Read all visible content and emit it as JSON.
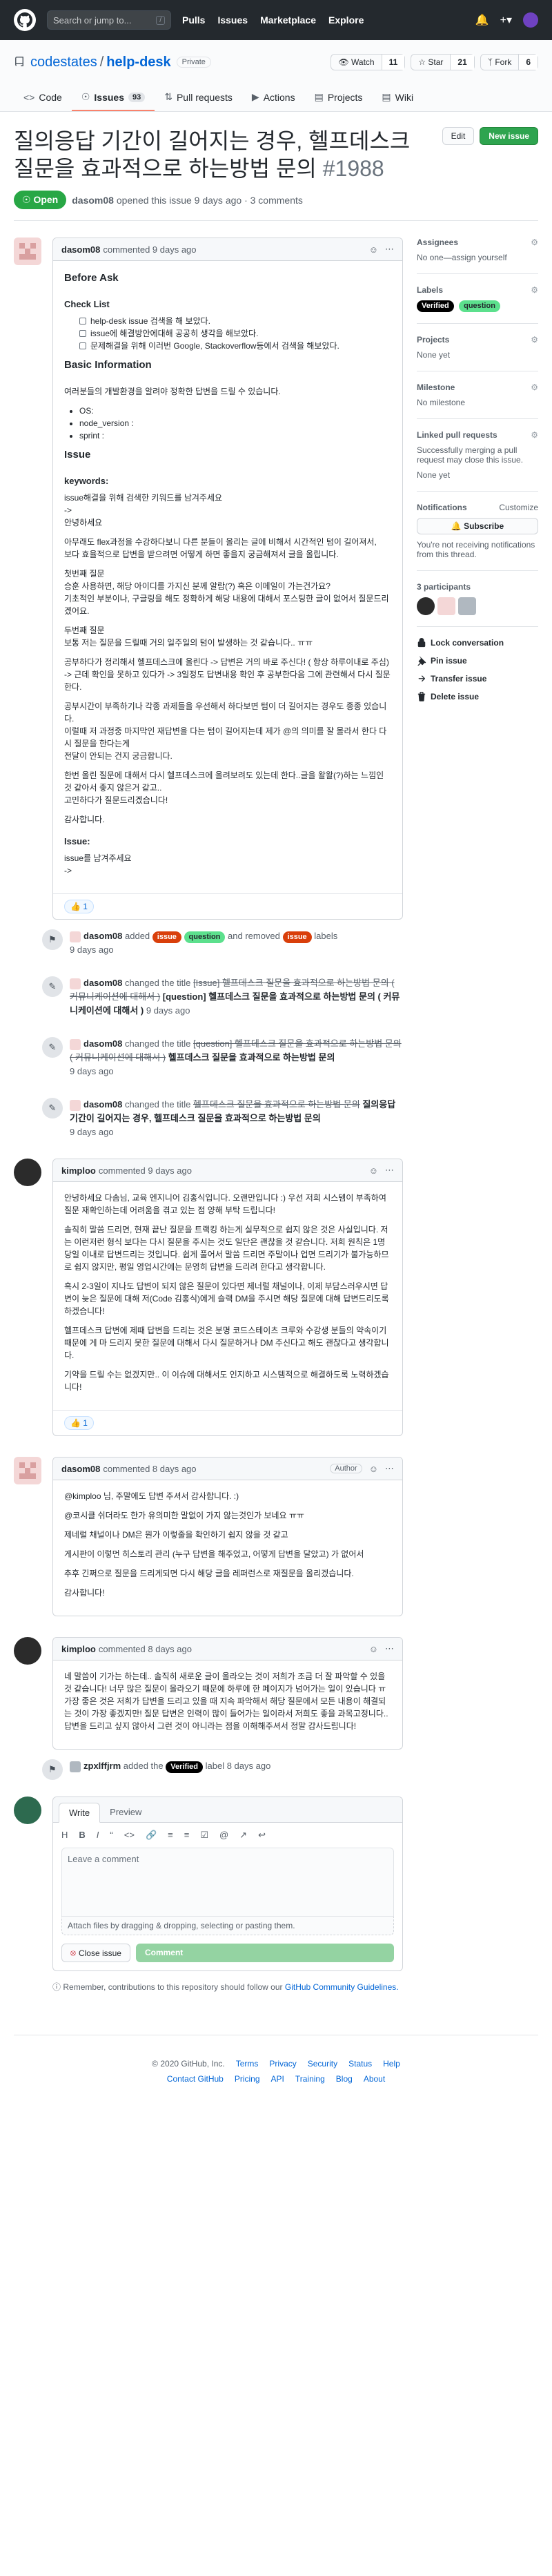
{
  "header": {
    "search_placeholder": "Search or jump to...",
    "search_key": "/",
    "nav": [
      "Pulls",
      "Issues",
      "Marketplace",
      "Explore"
    ]
  },
  "repo": {
    "owner": "codestates",
    "name": "help-desk",
    "visibility": "Private",
    "watch_label": "Watch",
    "watch_count": "11",
    "star_label": "Star",
    "star_count": "21",
    "fork_label": "Fork",
    "fork_count": "6",
    "tabs": [
      {
        "label": "Code"
      },
      {
        "label": "Issues",
        "count": "93"
      },
      {
        "label": "Pull requests"
      },
      {
        "label": "Actions"
      },
      {
        "label": "Projects"
      },
      {
        "label": "Wiki"
      }
    ]
  },
  "issue": {
    "title": "질의응답 기간이 길어지는 경우, 헬프데스크 질문을 효과적으로 하는방법 문의",
    "number": "#1988",
    "state": "Open",
    "edit_label": "Edit",
    "new_issue_label": "New issue",
    "author": "dasom08",
    "meta": "opened this issue 9 days ago · 3 comments"
  },
  "comments": {
    "first": {
      "author": "dasom08",
      "when": "commented 9 days ago",
      "before_ask": "Before Ask",
      "check_list": "Check List",
      "checks": [
        "help-desk issue 검색을 해 보았다.",
        "issue에 해결방안에대해 공공히 생각을 해보았다.",
        "문제해결을 위해 이러번 Google, Stackoverflow등에서 검색을 해보았다."
      ],
      "basic_info": "Basic Information",
      "basic_desc": "여러분들의 개발환경을 알려야 정확한 답변을 드릴 수 있습니다.",
      "info_items": [
        "OS:",
        "node_version :",
        "sprint :"
      ],
      "issue_heading": "Issue",
      "keywords": "keywords:",
      "p1": "issue해결을 위해 검색한 키워드를 남겨주세요",
      "p1b": "->",
      "p1c": "안녕하세요",
      "p2": "아무래도 flex과정을 수강하다보니 다른 분들이 올리는 글에 비해서 시간적인 텀이 길어져서,",
      "p2b": "보다 효율적으로 답변을 받으려면 어떻게 하면 좋을지 궁금해져서 글을 올립니다.",
      "p3": "첫번째 질문",
      "p3b": "승훈 사용하면, 해당 아이디를 가지신 분께 알람(?) 혹은 이메일이 가는건가요?",
      "p3c": "기초적인 부분이나, 구글링을 해도 정확하게 해당 내용에 대해서 포스팅한 글이 없어서 질문드리겠어요.",
      "p4": "두번째 질문",
      "p4b": "보통 저는 질문을 드릴때 거의 일주일의 텀이 발생하는 것 같습니다.. ㅠㅠ",
      "p5": "공부하다가 정리해서 헬프데스크에 올린다 -> 답변은 거의 바로 주신다! ( 항상 하루이내로 주심)",
      "p5b": "-> 근데 확인을 못하고 있다가 -> 3일정도 답변내용 확인 후 공부한다음 그에 관련해서 다시 질문한다.",
      "p6": "공부시간이 부족하기나 각종 과제들을 우선해서 하다보면 텀이 더 길어지는 경우도 종종 있습니다.",
      "p6b": "이럴때 저 과정중 마지막인 재답변을 다는 텀이 길어지는데 제가 @의 의미를 잘 몰라서 한다 다시 질문을 한다는게",
      "p6c": "전달이 안되는 건지 궁금합니다.",
      "p7": "한번 올린 질문에 대해서 다시 헬프데스크에 올려보려도 있는데 한다..글을 왈왈(?)하는 느낌인것 같아서 좋지 않은거 같고..",
      "p7b": "고민하다가 질문드리겠습니다!",
      "p8": "감사합니다.",
      "issue2": "Issue:",
      "p9": "issue를 남겨주세요",
      "p9b": "->",
      "reaction": "👍 1"
    },
    "second": {
      "author": "kimploo",
      "when": "commented 9 days ago",
      "p1": "안녕하세요 다솜님, 교육 엔지니어 김홍식입니다. 오랜만입니다 :) 우선 저희 시스템이 부족하여 질문 재확인하는데 어려움을 겪고 있는 점 양해 부탁 드립니다!",
      "p2": "솔직히 말씀 드리면, 현재 끝난 질문을 트랙킹 하는게 실무적으로 쉽지 않은 것은 사실입니다. 저는 이런저런 형식 보다는 다시 질문을 주시는 것도 일단은 괜찮을 것 같습니다. 저희 원칙은 1명당일 이내로 답변드리는 것입니다. 쉽게 풀어서 말씀 드리면 주말이나 업면 드리기가 불가능하므로 쉽지 않지만, 평일 영업시간에는 문영히 답변을 드리려 한다고 생각합니다.",
      "p3": "혹시 2-3일이 지나도 답변이 되지 않은 질문이 있다면 제너럴 채널이나, 이제 부담스러우시면 답변이 늦은 질문에 대해 저(Code 김홍식)에게 슬랙 DM을 주시면 해당 질문에 대해 답변드리도록 하겠습니다!",
      "p4": "헬프데스크 답변에 제때 답변을 드리는 것은 분명 코드스테이츠 크루와 수강생 분들의 약속이기 때문에 게 마 드리지 못한 질문에 대해서 다시 질문하거나 DM 주신다고 해도 괜찮다고 생각합니다.",
      "p5": "기약을 드릴 수는 없겠지만.. 이 이슈에 대해서도 인지하고 시스템적으로 해결하도록 노력하겠습니다!",
      "reaction": "👍 1"
    },
    "third": {
      "author": "dasom08",
      "when": "commented 8 days ago",
      "author_badge": "Author",
      "p1": "@kimploo 님, 주말에도 답변 주셔서 감사합니다. :)",
      "p2": "@코시클 쉬더라도 한가 유의미한 말없이 가지 않는것인가 보네요 ㅠㅠ",
      "p3": "제네럴 채널이나 DM은 뭔가 이렇줄을 확인하기 쉽지 않을 것 같고",
      "p4": "게시판이 이렇먼 히스토리 관리 (누구 답변을 해주었고, 어떻게 답변을 달았고) 가 없어서",
      "p5": "추후 긴쩌으로 질문을 드리게되면 다시 해당 글을 레퍼런스로 재질문을 올리겠습니다.",
      "p6": "감사합니다!"
    },
    "fourth": {
      "author": "kimploo",
      "when": "commented 8 days ago",
      "p1": "네 말씀이 기가는 하는데.. 솔직히 새로운 글이 올라오는 것이 저희가 조금 더 잘 파악할 수 있을 것 같습니다! 너무 많은 질문이 올라오기 때문에 하루에 한 페이지가 넘어가는 일이 있습니다 ㅠ 가장 좋은 것은 저희가 답변을 드리고 있을 때 지속 파악해서 해당 질문에서 모든 내용이 해결되는 것이 가장 좋겠지만! 질문 답변은 인력이 많이 들어가는 일이라서 저희도 좋을 과목고정니다.. 답변을 드리고 싶지 않아서 그런 것이 아니라는 점을 이해해주셔서 정말 감사드립니다!"
    }
  },
  "events": {
    "labels": {
      "actor": "dasom08",
      "added": "added",
      "label_issue": "issue",
      "label_question": "question",
      "and_removed": "and removed",
      "labels_word": "labels",
      "when": "9 days ago"
    },
    "rename1": {
      "actor": "dasom08",
      "changed": "changed the title",
      "old": "[Issue] 헬프데스크 질문을 효과적으로 하는방법 문의 ( 커뮤니케이션에 대해서 )",
      "new": "[question] 헬프데스크 질문을 효과적으로 하는방법 문의 ( 커뮤니케이션에 대해서 )",
      "when": "9 days ago"
    },
    "rename2": {
      "actor": "dasom08",
      "changed": "changed the title",
      "old": "[question] 헬프데스크 질문을 효과적으로 하는방법 문의 ( 커뮤니케이션에 대해서 )",
      "new": "헬프데스크 질문을 효과적으로 하는방법 문의",
      "when": "9 days ago"
    },
    "rename3": {
      "actor": "dasom08",
      "changed": "changed the title",
      "old": "헬프데스크 질문을 효과적으로 하는방법 문의",
      "new": "질의응답 기간이 길어지는 경우, 헬프데스크 질문을 효과적으로 하는방법 문의",
      "when": "9 days ago"
    },
    "verified": {
      "actor": "zpxlffjrm",
      "added": "added the",
      "label": "Verified",
      "tail": "label 8 days ago"
    }
  },
  "sidebar": {
    "assignees_title": "Assignees",
    "assignees_value": "No one—assign yourself",
    "labels_title": "Labels",
    "labels": [
      "Verified",
      "question"
    ],
    "projects_title": "Projects",
    "projects_value": "None yet",
    "milestone_title": "Milestone",
    "milestone_value": "No milestone",
    "linked_title": "Linked pull requests",
    "linked_desc": "Successfully merging a pull request may close this issue.",
    "linked_value": "None yet",
    "notif_title": "Notifications",
    "notif_customize": "Customize",
    "subscribe": "Subscribe",
    "notif_desc": "You're not receiving notifications from this thread.",
    "participants": "3 participants",
    "lock": "Lock conversation",
    "pin": "Pin issue",
    "transfer": "Transfer issue",
    "delete": "Delete issue"
  },
  "new_comment": {
    "tab_write": "Write",
    "tab_preview": "Preview",
    "placeholder": "Leave a comment",
    "attach": "Attach files by dragging & dropping, selecting or pasting them.",
    "close_issue": "Close issue",
    "comment": "Comment",
    "remember": "Remember, contributions to this repository should follow our",
    "guidelines": "GitHub Community Guidelines."
  },
  "footer": {
    "row1": [
      "© 2020 GitHub, Inc.",
      "Terms",
      "Privacy",
      "Security",
      "Status",
      "Help"
    ],
    "row2": [
      "Contact GitHub",
      "Pricing",
      "API",
      "Training",
      "Blog",
      "About"
    ]
  },
  "colors": {
    "header_bg": "#24292e",
    "open_green": "#28a745",
    "issue_label": "#d93f0b",
    "question_label": "#5ce08d",
    "verified_label": "#000000"
  }
}
